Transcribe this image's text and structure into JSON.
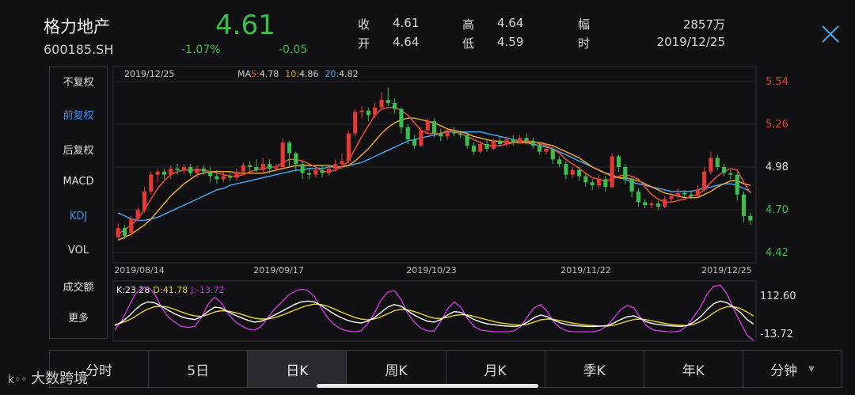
{
  "header": {
    "name": "格力地产",
    "code": "600185.SH",
    "price": "4.61",
    "change_pct": "-1.07%",
    "change": "-0.05",
    "quote": [
      {
        "label": "收",
        "value": "4.61"
      },
      {
        "label": "开",
        "value": "4.64"
      },
      {
        "label": "高",
        "value": "4.64"
      },
      {
        "label": "低",
        "value": "4.59"
      },
      {
        "label": "幅",
        "value": "2857万"
      },
      {
        "label": "时",
        "value": "2019/12/25"
      }
    ]
  },
  "sidebar": {
    "items": [
      "不复权",
      "前复权",
      "后复权",
      "MACD",
      "KDJ",
      "VOL",
      "成交额",
      "更多"
    ],
    "active": [
      "前复权",
      "KDJ"
    ]
  },
  "chart_data": {
    "type": "candlestick",
    "date_label": "2019/12/25",
    "ma_label": "MA",
    "ma5": {
      "label": "5:",
      "value": "4.78",
      "color": "#e8503a"
    },
    "ma10": {
      "label": "10:",
      "value": "4.86",
      "color": "#e8a33a"
    },
    "ma20": {
      "label": "20:",
      "value": "4.82",
      "color": "#4aa0e8"
    },
    "y_ticks": [
      "5.54",
      "5.26",
      "4.98",
      "4.70",
      "4.42"
    ],
    "x_ticks": [
      "2019/08/14",
      "2019/09/17",
      "2019/10/23",
      "2019/11/22",
      "2019/12/25"
    ],
    "ylim": [
      4.42,
      5.54
    ],
    "candles": [
      [
        4.52,
        4.58,
        4.61,
        4.5
      ],
      [
        4.58,
        4.53,
        4.6,
        4.51
      ],
      [
        4.55,
        4.64,
        4.66,
        4.52
      ],
      [
        4.64,
        4.7,
        4.72,
        4.62
      ],
      [
        4.7,
        4.82,
        4.85,
        4.68
      ],
      [
        4.82,
        4.93,
        4.95,
        4.8
      ],
      [
        4.93,
        4.95,
        4.97,
        4.88
      ],
      [
        4.95,
        4.93,
        4.97,
        4.9
      ],
      [
        4.93,
        4.97,
        4.99,
        4.9
      ],
      [
        4.97,
        4.96,
        5.0,
        4.93
      ],
      [
        4.96,
        4.98,
        5.0,
        4.93
      ],
      [
        4.98,
        4.94,
        5.0,
        4.92
      ],
      [
        4.94,
        4.97,
        4.99,
        4.91
      ],
      [
        4.97,
        4.95,
        4.99,
        4.93
      ],
      [
        4.95,
        4.92,
        4.98,
        4.88
      ],
      [
        4.92,
        4.9,
        4.96,
        4.87
      ],
      [
        4.9,
        4.92,
        4.95,
        4.88
      ],
      [
        4.92,
        4.91,
        4.94,
        4.89
      ],
      [
        4.91,
        4.95,
        4.97,
        4.89
      ],
      [
        4.95,
        4.99,
        5.01,
        4.93
      ],
      [
        4.99,
        4.98,
        5.02,
        4.95
      ],
      [
        4.98,
        4.96,
        5.03,
        4.95
      ],
      [
        4.96,
        5.0,
        5.04,
        4.94
      ],
      [
        5.0,
        4.97,
        5.03,
        4.94
      ],
      [
        4.97,
        4.98,
        5.0,
        4.95
      ],
      [
        4.98,
        5.14,
        5.17,
        4.96
      ],
      [
        5.14,
        5.07,
        5.15,
        4.98
      ],
      [
        5.07,
        5.0,
        5.08,
        4.95
      ],
      [
        5.0,
        4.94,
        5.02,
        4.9
      ],
      [
        4.94,
        4.93,
        4.97,
        4.9
      ],
      [
        4.93,
        4.96,
        4.98,
        4.91
      ],
      [
        4.96,
        4.94,
        4.99,
        4.91
      ],
      [
        4.94,
        4.97,
        4.99,
        4.92
      ],
      [
        4.97,
        5.0,
        5.03,
        4.95
      ],
      [
        5.0,
        5.02,
        5.07,
        4.97
      ],
      [
        5.02,
        5.2,
        5.22,
        5.0
      ],
      [
        5.2,
        5.34,
        5.36,
        5.18
      ],
      [
        5.34,
        5.35,
        5.38,
        5.3
      ],
      [
        5.35,
        5.32,
        5.37,
        5.28
      ],
      [
        5.32,
        5.37,
        5.4,
        5.3
      ],
      [
        5.37,
        5.42,
        5.47,
        5.35
      ],
      [
        5.42,
        5.4,
        5.5,
        5.38
      ],
      [
        5.4,
        5.36,
        5.43,
        5.33
      ],
      [
        5.36,
        5.24,
        5.37,
        5.2
      ],
      [
        5.24,
        5.16,
        5.26,
        5.13
      ],
      [
        5.16,
        5.12,
        5.19,
        5.1
      ],
      [
        5.12,
        5.22,
        5.24,
        5.11
      ],
      [
        5.22,
        5.28,
        5.3,
        5.2
      ],
      [
        5.28,
        5.2,
        5.3,
        5.18
      ],
      [
        5.2,
        5.18,
        5.23,
        5.15
      ],
      [
        5.18,
        5.21,
        5.23,
        5.16
      ],
      [
        5.21,
        5.2,
        5.24,
        5.18
      ],
      [
        5.2,
        5.19,
        5.22,
        5.17
      ],
      [
        5.19,
        5.12,
        5.2,
        5.1
      ],
      [
        5.12,
        5.08,
        5.14,
        5.06
      ],
      [
        5.08,
        5.13,
        5.15,
        5.07
      ],
      [
        5.13,
        5.1,
        5.16,
        5.08
      ],
      [
        5.1,
        5.15,
        5.17,
        5.09
      ],
      [
        5.15,
        5.13,
        5.18,
        5.12
      ],
      [
        5.13,
        5.16,
        5.18,
        5.11
      ],
      [
        5.16,
        5.14,
        5.19,
        5.12
      ],
      [
        5.14,
        5.17,
        5.19,
        5.13
      ],
      [
        5.17,
        5.15,
        5.2,
        5.13
      ],
      [
        5.15,
        5.12,
        5.17,
        5.1
      ],
      [
        5.12,
        5.08,
        5.14,
        5.06
      ],
      [
        5.08,
        5.1,
        5.12,
        5.06
      ],
      [
        5.1,
        5.03,
        5.11,
        5.0
      ],
      [
        5.03,
        5.0,
        5.05,
        4.98
      ],
      [
        5.0,
        4.93,
        5.02,
        4.9
      ],
      [
        4.93,
        4.96,
        4.98,
        4.91
      ],
      [
        4.96,
        4.92,
        4.98,
        4.89
      ],
      [
        4.92,
        4.88,
        4.94,
        4.85
      ],
      [
        4.88,
        4.86,
        4.9,
        4.83
      ],
      [
        4.86,
        4.9,
        4.93,
        4.84
      ],
      [
        4.9,
        4.85,
        4.92,
        4.82
      ],
      [
        4.85,
        5.05,
        5.07,
        4.84
      ],
      [
        5.05,
        4.98,
        5.06,
        4.95
      ],
      [
        4.98,
        4.9,
        5.0,
        4.87
      ],
      [
        4.9,
        4.82,
        4.92,
        4.78
      ],
      [
        4.82,
        4.75,
        4.84,
        4.72
      ],
      [
        4.75,
        4.73,
        4.77,
        4.71
      ],
      [
        4.73,
        4.74,
        4.76,
        4.71
      ],
      [
        4.74,
        4.72,
        4.76,
        4.7
      ],
      [
        4.72,
        4.77,
        4.79,
        4.71
      ],
      [
        4.77,
        4.79,
        4.81,
        4.75
      ],
      [
        4.79,
        4.81,
        4.84,
        4.77
      ],
      [
        4.81,
        4.8,
        4.83,
        4.78
      ],
      [
        4.8,
        4.79,
        4.83,
        4.77
      ],
      [
        4.79,
        4.83,
        4.86,
        4.78
      ],
      [
        4.83,
        4.95,
        4.98,
        4.82
      ],
      [
        4.95,
        5.04,
        5.08,
        4.93
      ],
      [
        5.04,
        4.98,
        5.06,
        4.96
      ],
      [
        4.98,
        4.94,
        5.0,
        4.92
      ],
      [
        4.94,
        4.93,
        4.96,
        4.9
      ],
      [
        4.93,
        4.8,
        4.95,
        4.76
      ],
      [
        4.8,
        4.66,
        4.82,
        4.62
      ],
      [
        4.66,
        4.63,
        4.68,
        4.6
      ]
    ],
    "ma5_line": [
      4.54,
      4.57,
      4.6,
      4.64,
      4.7,
      4.77,
      4.84,
      4.89,
      4.93,
      4.95,
      4.96,
      4.96,
      4.96,
      4.96,
      4.95,
      4.94,
      4.93,
      4.92,
      4.92,
      4.93,
      4.95,
      4.96,
      4.97,
      4.98,
      4.98,
      5.01,
      5.03,
      5.03,
      5.02,
      5.0,
      4.98,
      4.95,
      4.95,
      4.96,
      4.98,
      5.02,
      5.1,
      5.18,
      5.25,
      5.32,
      5.36,
      5.37,
      5.37,
      5.35,
      5.32,
      5.27,
      5.22,
      5.2,
      5.2,
      5.2,
      5.22,
      5.21,
      5.2,
      5.18,
      5.16,
      5.14,
      5.12,
      5.12,
      5.12,
      5.13,
      5.14,
      5.15,
      5.15,
      5.15,
      5.13,
      5.12,
      5.1,
      5.07,
      5.03,
      5.0,
      4.97,
      4.94,
      4.91,
      4.9,
      4.89,
      4.9,
      4.92,
      4.93,
      4.92,
      4.9,
      4.85,
      4.8,
      4.77,
      4.75,
      4.75,
      4.76,
      4.77,
      4.79,
      4.8,
      4.83,
      4.88,
      4.92,
      4.95,
      4.97,
      4.96,
      4.88,
      4.81
    ],
    "ma10_line": [
      4.5,
      4.52,
      4.54,
      4.57,
      4.6,
      4.64,
      4.69,
      4.74,
      4.79,
      4.83,
      4.87,
      4.9,
      4.93,
      4.94,
      4.95,
      4.95,
      4.95,
      4.95,
      4.94,
      4.94,
      4.94,
      4.94,
      4.94,
      4.95,
      4.96,
      4.97,
      4.98,
      4.99,
      4.99,
      4.99,
      4.99,
      4.99,
      4.99,
      4.98,
      4.98,
      4.99,
      5.02,
      5.06,
      5.1,
      5.15,
      5.2,
      5.24,
      5.27,
      5.29,
      5.3,
      5.3,
      5.29,
      5.28,
      5.27,
      5.25,
      5.23,
      5.22,
      5.21,
      5.2,
      5.18,
      5.17,
      5.16,
      5.15,
      5.15,
      5.14,
      5.14,
      5.14,
      5.14,
      5.14,
      5.14,
      5.13,
      5.12,
      5.1,
      5.08,
      5.06,
      5.04,
      5.01,
      4.98,
      4.96,
      4.94,
      4.92,
      4.91,
      4.91,
      4.9,
      4.89,
      4.87,
      4.85,
      4.83,
      4.81,
      4.8,
      4.79,
      4.78,
      4.78,
      4.78,
      4.8,
      4.82,
      4.85,
      4.87,
      4.89,
      4.89,
      4.87,
      4.86
    ],
    "ma20_line": [
      4.68,
      4.66,
      4.64,
      4.63,
      4.63,
      4.64,
      4.65,
      4.67,
      4.69,
      4.71,
      4.73,
      4.75,
      4.77,
      4.79,
      4.81,
      4.83,
      4.84,
      4.86,
      4.87,
      4.88,
      4.89,
      4.9,
      4.91,
      4.92,
      4.93,
      4.94,
      4.95,
      4.96,
      4.96,
      4.97,
      4.97,
      4.97,
      4.98,
      4.98,
      4.98,
      4.99,
      5.0,
      5.01,
      5.03,
      5.05,
      5.07,
      5.09,
      5.11,
      5.13,
      5.15,
      5.16,
      5.17,
      5.18,
      5.19,
      5.2,
      5.21,
      5.21,
      5.21,
      5.21,
      5.21,
      5.21,
      5.2,
      5.19,
      5.18,
      5.17,
      5.16,
      5.15,
      5.14,
      5.13,
      5.12,
      5.11,
      5.1,
      5.08,
      5.06,
      5.04,
      5.02,
      5.0,
      4.98,
      4.96,
      4.94,
      4.93,
      4.91,
      4.9,
      4.88,
      4.87,
      4.86,
      4.85,
      4.84,
      4.83,
      4.82,
      4.82,
      4.82,
      4.82,
      4.83,
      4.84,
      4.85,
      4.86,
      4.87,
      4.87,
      4.86,
      4.84,
      4.82
    ],
    "kdj": {
      "label_k": "K:23.28",
      "label_d": "D:41.78",
      "label_j": "J:-13.72",
      "y_ticks": [
        "112.60",
        "-13.72"
      ],
      "ylim": [
        -13.72,
        112.6
      ],
      "k": [
        20,
        28,
        40,
        55,
        68,
        74,
        72,
        64,
        55,
        47,
        40,
        36,
        34,
        40,
        52,
        62,
        60,
        52,
        44,
        38,
        32,
        28,
        30,
        36,
        44,
        52,
        60,
        68,
        74,
        76,
        74,
        66,
        56,
        46,
        38,
        32,
        28,
        26,
        30,
        38,
        50,
        62,
        68,
        64,
        54,
        44,
        36,
        30,
        28,
        34,
        44,
        52,
        50,
        42,
        34,
        28,
        24,
        22,
        20,
        19,
        18,
        20,
        28,
        38,
        44,
        40,
        32,
        26,
        22,
        20,
        19,
        18,
        18,
        19,
        20,
        26,
        34,
        40,
        42,
        36,
        28,
        24,
        22,
        20,
        19,
        18,
        20,
        28,
        40,
        56,
        70,
        76,
        72,
        62,
        50,
        34,
        23.28
      ],
      "d": [
        22,
        26,
        32,
        40,
        50,
        58,
        63,
        64,
        62,
        57,
        51,
        46,
        42,
        41,
        45,
        51,
        54,
        53,
        50,
        46,
        41,
        37,
        35,
        35,
        38,
        43,
        49,
        55,
        61,
        66,
        69,
        68,
        64,
        58,
        51,
        45,
        39,
        35,
        33,
        35,
        40,
        47,
        54,
        57,
        56,
        52,
        47,
        41,
        37,
        36,
        39,
        43,
        45,
        44,
        41,
        37,
        33,
        29,
        26,
        24,
        22,
        21,
        23,
        28,
        33,
        35,
        34,
        31,
        28,
        25,
        23,
        21,
        20,
        19,
        19,
        21,
        25,
        30,
        34,
        35,
        33,
        30,
        27,
        24,
        22,
        21,
        20,
        23,
        29,
        38,
        49,
        58,
        63,
        63,
        59,
        51,
        41.78
      ],
      "j": [
        10,
        30,
        60,
        90,
        105,
        108,
        92,
        62,
        40,
        28,
        18,
        16,
        18,
        38,
        68,
        85,
        72,
        48,
        30,
        20,
        12,
        10,
        18,
        38,
        58,
        72,
        88,
        98,
        103,
        100,
        86,
        60,
        38,
        22,
        12,
        8,
        6,
        8,
        24,
        48,
        78,
        96,
        100,
        80,
        48,
        28,
        14,
        8,
        8,
        30,
        58,
        74,
        62,
        36,
        18,
        10,
        8,
        6,
        6,
        6,
        8,
        18,
        40,
        60,
        68,
        52,
        28,
        14,
        8,
        6,
        6,
        6,
        6,
        10,
        20,
        38,
        56,
        66,
        60,
        38,
        18,
        10,
        8,
        6,
        6,
        8,
        20,
        40,
        62,
        92,
        110,
        112,
        92,
        58,
        28,
        -2,
        -13.72
      ]
    }
  },
  "tabs": {
    "items": [
      "分时",
      "5日",
      "日K",
      "周K",
      "月K",
      "季K",
      "年K",
      "分钟"
    ],
    "active": "日K"
  },
  "watermark": "大数跨境",
  "colors": {
    "up": "#e53935",
    "down": "#3ebd4f",
    "k": "#ffffff",
    "d": "#e4d03a",
    "j": "#c83ad6",
    "accent": "#3d8bf0"
  }
}
